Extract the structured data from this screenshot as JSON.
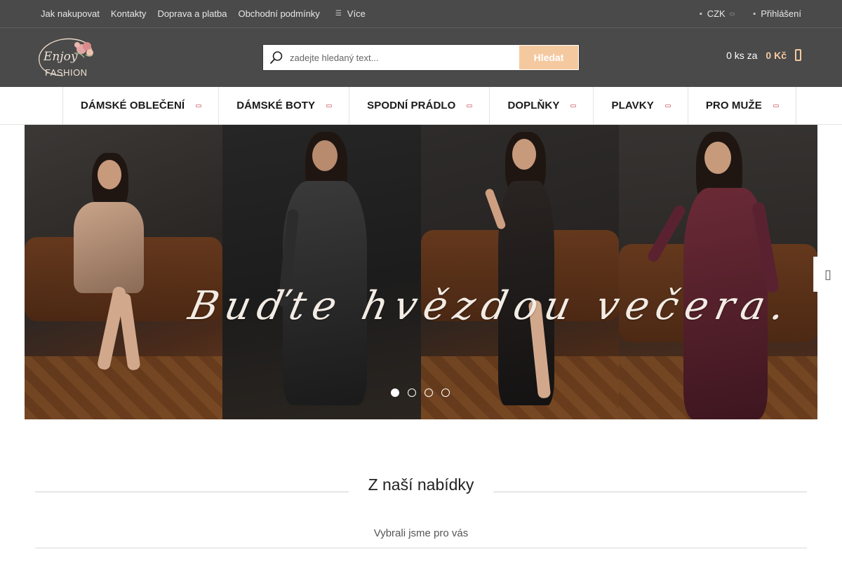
{
  "topbar": {
    "links": [
      "Jak nakupovat",
      "Kontakty",
      "Doprava a platba",
      "Obchodní podmínky"
    ],
    "more_label": "Více",
    "currency": "CZK",
    "login": "Přihlášení"
  },
  "header": {
    "logo_text": "FASHION",
    "logo_script": "Enjoy",
    "search_placeholder": "zadejte hledaný text...",
    "search_button": "Hledat",
    "cart_count": "0 ks za",
    "cart_price": "0 Kč"
  },
  "mainnav": {
    "items": [
      "DÁMSKÉ OBLEČENÍ",
      "DÁMSKÉ BOTY",
      "SPODNÍ PRÁDLO",
      "DOPLŇKY",
      "PLAVKY",
      "PRO MUŽE"
    ]
  },
  "banner": {
    "script_text": "Buďte hvězdou večera.",
    "slides": 4,
    "active_slide": 1
  },
  "section": {
    "title": "Z naší nabídky",
    "subtitle": "Vybrali jsme pro vás"
  },
  "colors": {
    "header_bg": "#4a4a4a",
    "accent": "#f5c9a0",
    "dropdown_marker": "#d98a95"
  },
  "icons": [
    "more-icon",
    "currency-icon",
    "user-icon",
    "search-icon",
    "cart-icon",
    "slider-next-icon"
  ]
}
